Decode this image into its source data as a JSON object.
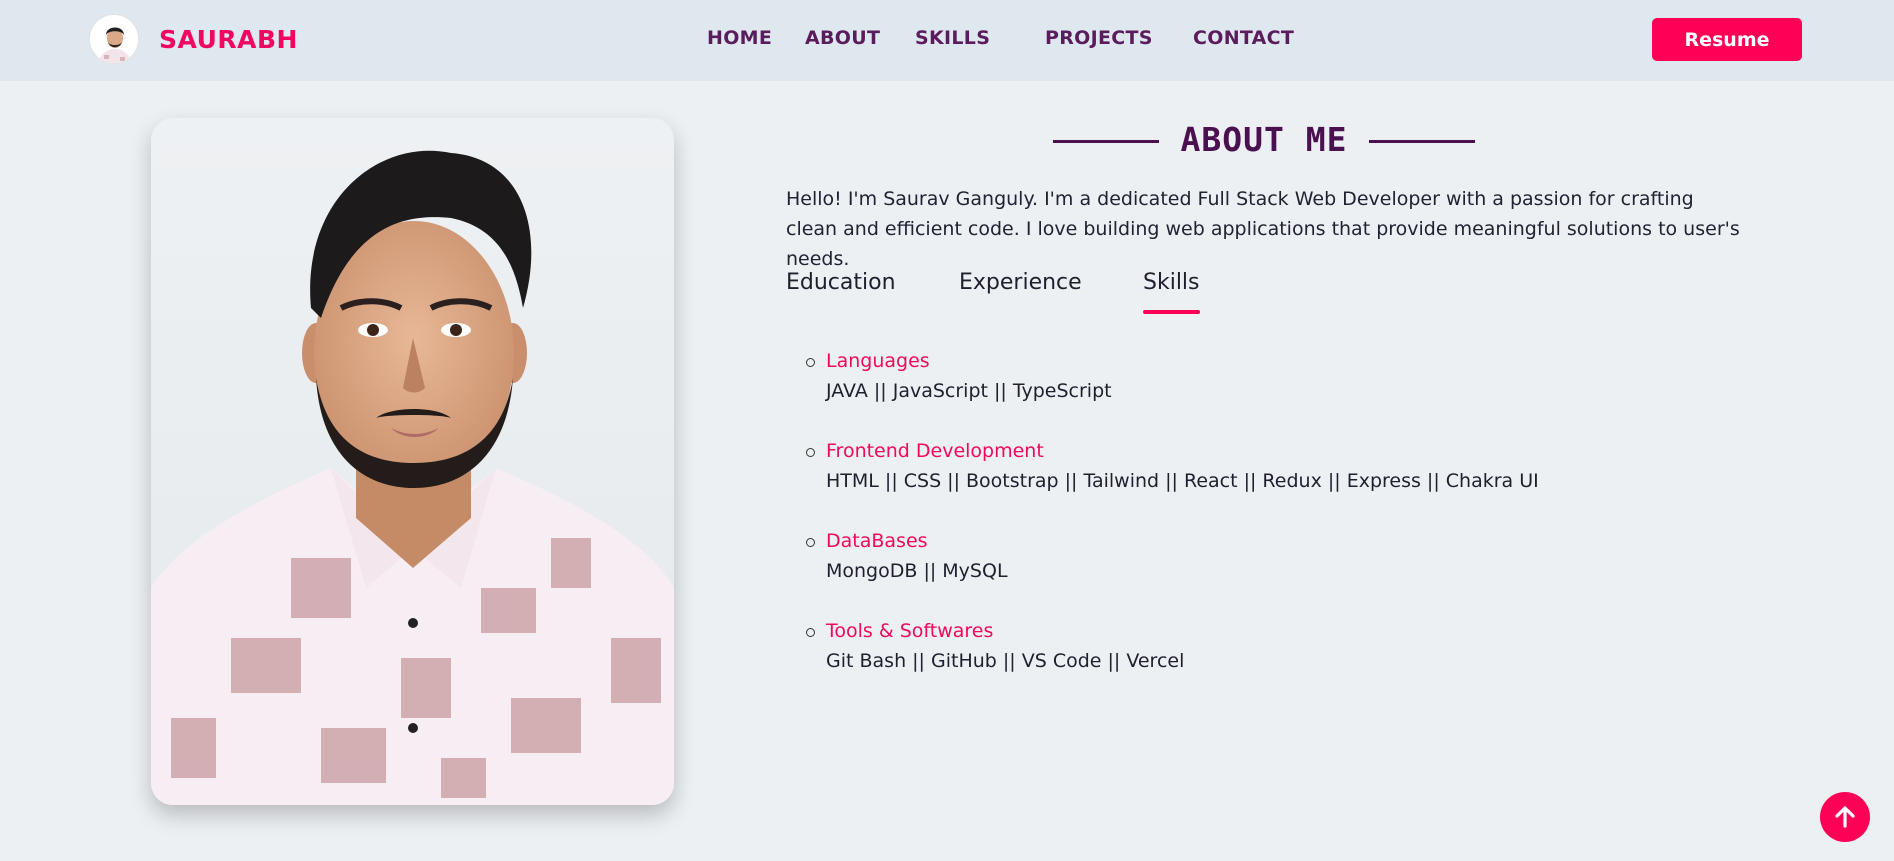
{
  "brand": {
    "name": "SAURABH"
  },
  "nav": {
    "items": [
      {
        "label": "HOME"
      },
      {
        "label": "ABOUT"
      },
      {
        "label": "SKILLS"
      },
      {
        "label": "PROJECTS"
      },
      {
        "label": "CONTACT"
      }
    ],
    "resume_label": "Resume"
  },
  "about": {
    "heading": "ABOUT ME",
    "intro": "Hello! I'm Saurav Ganguly. I'm a dedicated Full Stack Web Developer with a passion for crafting clean and efficient code. I love building web applications that provide meaningful solutions to user's needs.",
    "tabs": [
      {
        "label": "Education"
      },
      {
        "label": "Experience"
      },
      {
        "label": "Skills"
      }
    ],
    "active_tab": "Skills",
    "skills": [
      {
        "title": "Languages",
        "items": "JAVA || JavaScript || TypeScript"
      },
      {
        "title": "Frontend Development",
        "items": "HTML || CSS || Bootstrap || Tailwind || React || Redux || Express || Chakra UI"
      },
      {
        "title": "DataBases",
        "items": "MongoDB || MySQL"
      },
      {
        "title": "Tools & Softwares",
        "items": "Git Bash || GitHub || VS Code || Vercel"
      }
    ]
  },
  "icons": {
    "scroll_top": "arrow-up-icon"
  },
  "colors": {
    "accent": "#ff0057",
    "brand_text": "#f0085e",
    "nav_text": "#5b1c5d",
    "heading": "#4a1050",
    "page_bg": "#ecf0f3",
    "navbar_bg": "#dfe8ee"
  }
}
